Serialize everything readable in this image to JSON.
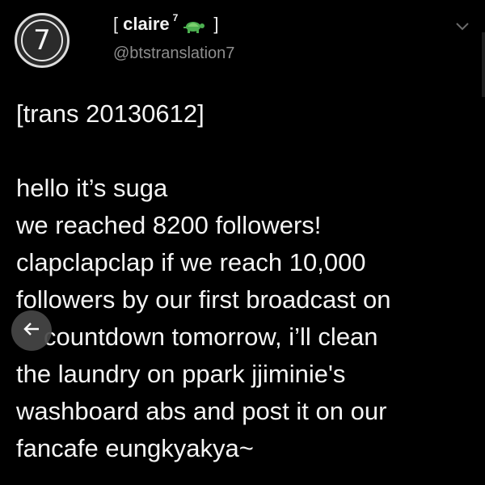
{
  "tweet": {
    "avatar_text": "7",
    "display_name": {
      "open_bracket": "[",
      "name": "claire",
      "superscript": "7",
      "close_bracket": "]"
    },
    "handle": "@btstranslation7",
    "text_lines": [
      "[trans 20130612]",
      "",
      "hello it’s suga",
      "we reached 8200 followers!",
      "clapclapclap if we reach 10,000",
      "followers by our first broadcast on",
      "countdown tomorrow, i’ll clean",
      "the laundry on ppark jjiminie's",
      "washboard abs and post it on our",
      "fancafe eungkyakya~"
    ]
  },
  "icons": {
    "turtle": "turtle-emoji-icon",
    "caret": "chevron-down-icon",
    "back": "arrow-left-icon"
  },
  "colors": {
    "background": "#000000",
    "text": "#f4f4f4",
    "handle": "#8e8e8e",
    "turtle": "#4caf50"
  }
}
